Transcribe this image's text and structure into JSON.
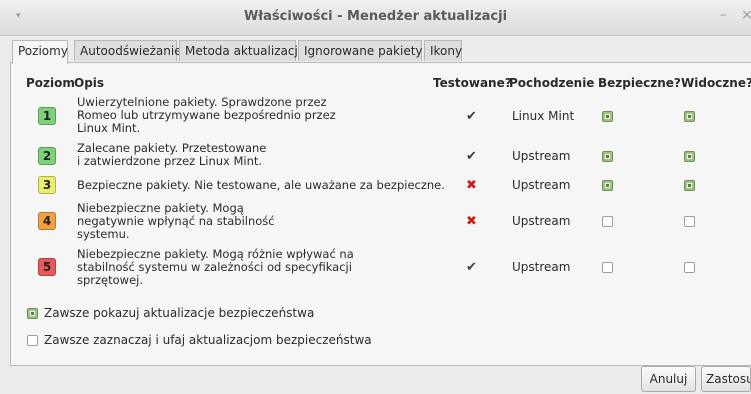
{
  "window": {
    "title": "Właściwości - Menedżer aktualizacji",
    "menu_glyph": "▾",
    "minimize_glyph": "–",
    "close_glyph": "×"
  },
  "tabs": [
    {
      "label": "Poziomy",
      "active": true
    },
    {
      "label": "Autoodświeżanie",
      "active": false
    },
    {
      "label": "Metoda aktualizacji",
      "active": false
    },
    {
      "label": "Ignorowane pakiety",
      "active": false
    },
    {
      "label": "Ikony",
      "active": false
    }
  ],
  "table": {
    "headers": {
      "level": "Poziom",
      "description": "Opis",
      "tested": "Testowane?",
      "origin": "Pochodzenie",
      "safe": "Bezpieczne?",
      "visible": "Widoczne?"
    },
    "rows": [
      {
        "level": "1",
        "color": "#7fd07a",
        "description": [
          "Uwierzytelnione pakiety. Sprawdzone przez",
          "Romeo lub utrzymywane bezpośrednio przez",
          "Linux Mint."
        ],
        "tested_icon": "✔",
        "tested": true,
        "origin": "Linux Mint",
        "safe": true,
        "visible": true
      },
      {
        "level": "2",
        "color": "#7fd07a",
        "description": [
          "Zalecane pakiety. Przetestowane",
          "i zatwierdzone przez Linux Mint."
        ],
        "tested_icon": "✔",
        "tested": true,
        "origin": "Upstream",
        "safe": true,
        "visible": true
      },
      {
        "level": "3",
        "color": "#ecec6e",
        "description": [
          "Bezpieczne pakiety. Nie testowane, ale uważane za bezpieczne."
        ],
        "tested_icon": "✖",
        "tested": false,
        "origin": "Upstream",
        "safe": true,
        "visible": true
      },
      {
        "level": "4",
        "color": "#f2a040",
        "description": [
          "Niebezpieczne pakiety. Mogą",
          "negatywnie wpłynąć na stabilność",
          "systemu."
        ],
        "tested_icon": "✖",
        "tested": false,
        "origin": "Upstream",
        "safe": false,
        "visible": false
      },
      {
        "level": "5",
        "color": "#e45a5a",
        "description": [
          "Niebezpieczne pakiety. Mogą różnie wpływać na",
          "stabilność systemu w zależności od specyfikacji",
          "sprzętowej."
        ],
        "tested_icon": "✔",
        "tested": true,
        "origin": "Upstream",
        "safe": false,
        "visible": false
      }
    ]
  },
  "options": [
    {
      "label": "Zawsze pokazuj aktualizacje bezpieczeństwa",
      "checked": true
    },
    {
      "label": "Zawsze zaznaczaj i ufaj aktualizacjom bezpieczeństwa",
      "checked": false
    }
  ],
  "buttons": {
    "cancel": "Anuluj",
    "apply": "Zastosuj"
  }
}
